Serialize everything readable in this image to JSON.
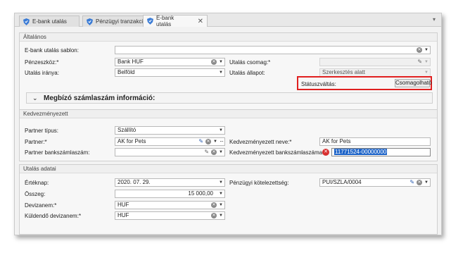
{
  "tabs": [
    {
      "label": "E-bank utalás",
      "active": false
    },
    {
      "label": "Pénzügyi tranzakció",
      "active": false
    },
    {
      "label": "E-bank utalás",
      "active": true
    }
  ],
  "tab_close": "✕",
  "tab_menu": "▾",
  "general": {
    "title": "Általános",
    "template_label": "E-bank utalás sablon:",
    "template_value": "",
    "account_label": "Pénzeszköz:*",
    "account_value": "Bank HUF",
    "direction_label": "Utalás iránya:",
    "direction_value": "Belföld",
    "package_label": "Utalás csomag:*",
    "package_value": "",
    "state_label": "Utalás állapot:",
    "state_value": "Szerkesztés alatt",
    "status_change_label": "Státuszváltás:",
    "status_change_button": "Csomagolható",
    "collapse_title": "Megbízó számlaszám információ:"
  },
  "beneficiary": {
    "title": "Kedvezményezett",
    "partner_type_label": "Partner típus:",
    "partner_type_value": "Szállító",
    "partner_label": "Partner:*",
    "partner_value": "AK for Pets",
    "partner_account_label": "Partner bankszámlaszám:",
    "partner_account_value": "",
    "name_label": "Kedvezményezett neve:*",
    "name_value": "AK for Pets",
    "account_label": "Kedvezményezett bankszámlaszáma:*",
    "account_value": "11771524-00000000"
  },
  "transfer": {
    "title": "Utalás adatai",
    "value_date_label": "Értéknap:",
    "value_date_value": "2020. 07. 29.",
    "amount_label": "Összeg:",
    "amount_value": "15 000,00",
    "currency_label": "Devizanem:*",
    "currency_value": "HUF",
    "send_currency_label": "Küldendő devizanem:*",
    "send_currency_value": "HUF",
    "obligation_label": "Pénzügyi kötelezettség:",
    "obligation_value": "PUI/SZLA/0004"
  },
  "icons": {
    "tab_icon": "shield-icon",
    "clear": "clear-icon",
    "dropdown": "chevron-down-icon",
    "edit": "pencil-icon",
    "more": "more-icon",
    "error": "error-icon",
    "calendar": "calendar-icon",
    "status_highlight_color": "#e02020",
    "selection_color": "#1e64c8"
  }
}
